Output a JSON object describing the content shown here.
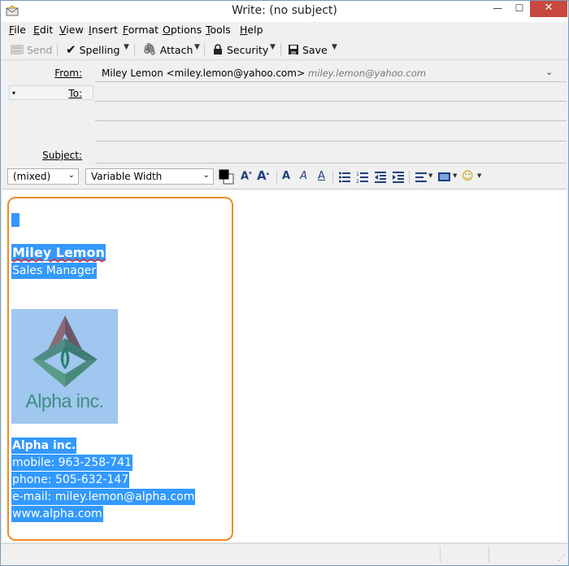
{
  "window": {
    "title": "Write: (no subject)",
    "min_glyph": "—",
    "max_glyph": "☐",
    "close_glyph": "✕"
  },
  "menu": {
    "items": [
      {
        "key": "F",
        "rest": "ile"
      },
      {
        "key": "E",
        "rest": "dit"
      },
      {
        "key": "V",
        "rest": "iew"
      },
      {
        "key": "I",
        "rest": "nsert"
      },
      {
        "key": "F",
        "rest": "ormat"
      },
      {
        "key": "O",
        "rest": "ptions"
      },
      {
        "key": "T",
        "rest": "ools"
      },
      {
        "key": "H",
        "rest": "elp"
      }
    ]
  },
  "toolbar": {
    "send": "Send",
    "spelling": "Spelling",
    "attach": "Attach",
    "security": "Security",
    "save": "Save",
    "dropdown_glyph": "▼"
  },
  "header": {
    "from_label": "From:",
    "from_value": "Miley Lemon <miley.lemon@yahoo.com>",
    "from_hint": "miley.lemon@yahoo.com",
    "to_label": "To:",
    "subject_label": "Subject:",
    "to_value": "",
    "subject_value": ""
  },
  "format": {
    "paragraph_style": "(mixed)",
    "font": "Variable Width"
  },
  "signature": {
    "name": "Miley Lemon",
    "title": "Sales Manager",
    "logo_text": "Alpha inc.",
    "company": "Alpha inc.",
    "mobile": "mobile: 963-258-741",
    "phone": "phone: 505-632-147",
    "email": "e-mail: miley.lemon@alpha.com",
    "website": "www.alpha.com"
  },
  "colors": {
    "selection": "#3399ff",
    "highlight_border": "#f08a24",
    "close_button": "#c7483e"
  }
}
